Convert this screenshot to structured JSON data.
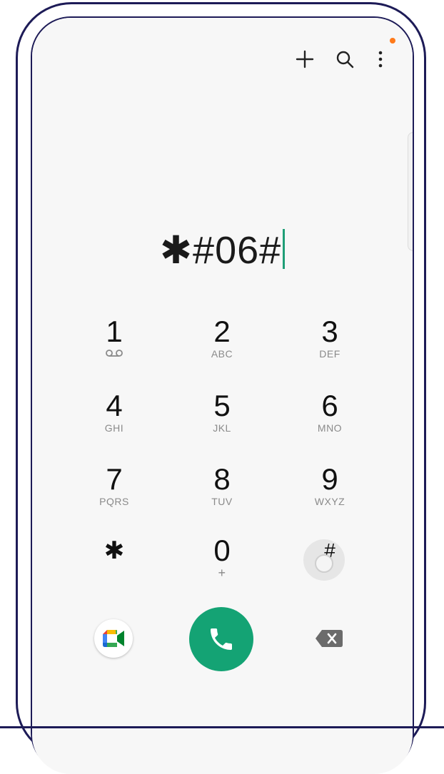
{
  "topbar": {
    "add_icon": "plus-icon",
    "search_icon": "search-icon",
    "more_icon": "more-vertical-icon",
    "notification_color": "#ff7a1a"
  },
  "dialer": {
    "entered_number": "✱#06#",
    "caret_color": "#1f9e77"
  },
  "keypad": {
    "keys": [
      {
        "digit": "1",
        "letters": "",
        "icon": "voicemail-icon"
      },
      {
        "digit": "2",
        "letters": "ABC"
      },
      {
        "digit": "3",
        "letters": "DEF"
      },
      {
        "digit": "4",
        "letters": "GHI"
      },
      {
        "digit": "5",
        "letters": "JKL"
      },
      {
        "digit": "6",
        "letters": "MNO"
      },
      {
        "digit": "7",
        "letters": "PQRS"
      },
      {
        "digit": "8",
        "letters": "TUV"
      },
      {
        "digit": "9",
        "letters": "WXYZ"
      },
      {
        "digit": "✱",
        "letters": ""
      },
      {
        "digit": "0",
        "letters": "+"
      },
      {
        "digit": "#",
        "letters": ""
      }
    ]
  },
  "actions": {
    "video_call_icon": "google-meet-icon",
    "call_icon": "phone-icon",
    "call_color": "#14a374",
    "backspace_icon": "backspace-icon"
  }
}
